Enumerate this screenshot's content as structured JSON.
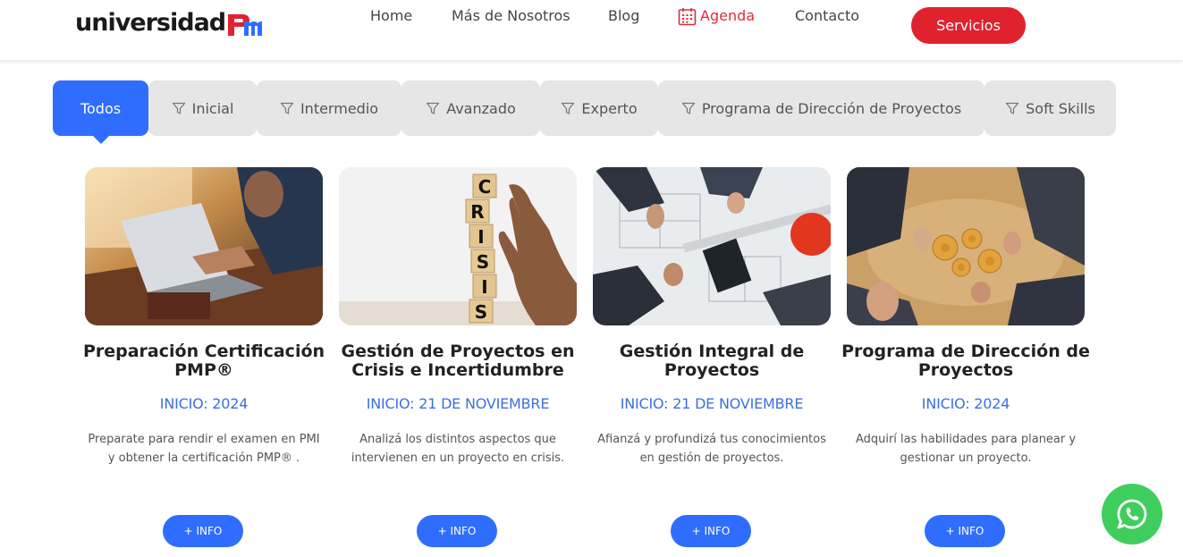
{
  "header": {
    "logo_text": "universidad",
    "logo_mark": "Pm",
    "nav": {
      "home": "Home",
      "mas": "Más de Nosotros",
      "blog": "Blog",
      "agenda": "Agenda",
      "contacto": "Contacto"
    },
    "servicios_label": "Servicios"
  },
  "tabs": [
    {
      "label": "Todos",
      "active": true
    },
    {
      "label": "Inicial",
      "active": false
    },
    {
      "label": "Intermedio",
      "active": false
    },
    {
      "label": "Avanzado",
      "active": false
    },
    {
      "label": "Experto",
      "active": false
    },
    {
      "label": "Programa de Dirección de Proyectos",
      "active": false
    },
    {
      "label": "Soft Skills",
      "active": false
    }
  ],
  "cards": [
    {
      "title": "Preparación Certificación PMP®",
      "inicio": "INICIO: 2024",
      "desc": "Preparate para rendir el examen en PMI y obtener la certificación PMP® .",
      "button": "+ INFO",
      "image": "laptop-work-photo"
    },
    {
      "title": "Gestión de Proyectos en Crisis e Incertidumbre",
      "inicio": "INICIO: 21 DE NOVIEMBRE",
      "desc": "Analizá los distintos aspectos que intervienen en un proyecto en crisis.",
      "button": "+ INFO",
      "image": "crisis-blocks-photo"
    },
    {
      "title": "Gestión Integral de Proyectos",
      "inicio": "INICIO: 21 DE NOVIEMBRE",
      "desc": "Afianzá y profundizá tus conocimientos en gestión de proyectos.",
      "button": "+ INFO",
      "image": "blueprint-team-photo"
    },
    {
      "title": "Programa de Dirección de Proyectos",
      "inicio": "INICIO: 2024",
      "desc": "Adquirí las habilidades para planear y gestionar un proyecto.",
      "button": "+ INFO",
      "image": "gears-team-photo"
    }
  ],
  "colors": {
    "accent_blue": "#2f6dff",
    "accent_red": "#e0222e",
    "whatsapp_green": "#3fce5d"
  }
}
